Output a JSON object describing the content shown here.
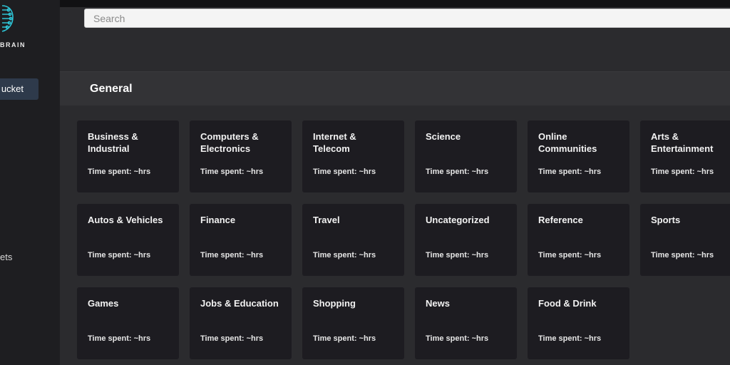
{
  "brand": {
    "name": "BRAIN"
  },
  "sidebar": {
    "active_item": "ucket",
    "item2": "ets"
  },
  "search": {
    "placeholder": "Search"
  },
  "section": {
    "title": "General"
  },
  "cards": [
    {
      "title": "Business & Industrial",
      "time": "Time spent: ~hrs"
    },
    {
      "title": "Computers & Electronics",
      "time": "Time spent: ~hrs"
    },
    {
      "title": "Internet & Telecom",
      "time": "Time spent: ~hrs"
    },
    {
      "title": "Science",
      "time": "Time spent: ~hrs"
    },
    {
      "title": "Online Communities",
      "time": "Time spent: ~hrs"
    },
    {
      "title": "Arts & Entertainment",
      "time": "Time spent: ~hrs"
    },
    {
      "title": "Autos & Vehicles",
      "time": "Time spent: ~hrs"
    },
    {
      "title": "Finance",
      "time": "Time spent: ~hrs"
    },
    {
      "title": "Travel",
      "time": "Time spent: ~hrs"
    },
    {
      "title": "Uncategorized",
      "time": "Time spent: ~hrs"
    },
    {
      "title": "Reference",
      "time": "Time spent: ~hrs"
    },
    {
      "title": "Sports",
      "time": "Time spent: ~hrs"
    },
    {
      "title": "Games",
      "time": "Time spent: ~hrs"
    },
    {
      "title": "Jobs & Education",
      "time": "Time spent: ~hrs"
    },
    {
      "title": "Shopping",
      "time": "Time spent: ~hrs"
    },
    {
      "title": "News",
      "time": "Time spent: ~hrs"
    },
    {
      "title": "Food & Drink",
      "time": "Time spent: ~hrs"
    }
  ],
  "colors": {
    "accent": "#2ec4d6",
    "card_bg": "#1d1c21",
    "nav_active": "#2e3a4b"
  }
}
